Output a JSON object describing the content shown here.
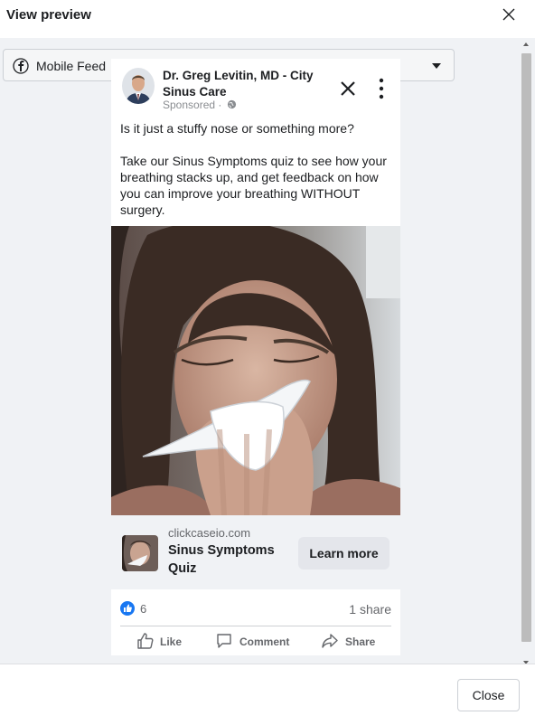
{
  "header": {
    "title": "View preview"
  },
  "placement_select": {
    "value": "Mobile Feed"
  },
  "ad": {
    "page_name": "Dr. Greg Levitin, MD - City Sinus Care",
    "sponsored": "Sponsored ·",
    "primary_text_1": "Is it just a stuffy nose or something more?",
    "primary_text_2": "Take our Sinus Symptoms quiz to see how your breathing stacks up, and get feedback on how you can improve your breathing WITHOUT surgery.",
    "link_domain": "clickcaseio.com",
    "link_headline": "Sinus Symptoms Quiz",
    "cta_label": "Learn more",
    "reaction_count": "6",
    "share_count": "1 share",
    "actions": {
      "like": "Like",
      "comment": "Comment",
      "share": "Share"
    }
  },
  "footer": {
    "close_label": "Close"
  },
  "icons": {
    "close": "close-icon",
    "facebook": "facebook-icon",
    "dropdown": "caret-down-icon",
    "more": "more-vertical-icon",
    "globe": "globe-icon",
    "like_reaction": "like-reaction-icon",
    "like": "thumbs-up-icon",
    "comment": "comment-icon",
    "share": "share-icon"
  },
  "colors": {
    "accent": "#1877f2",
    "background": "#f0f2f5",
    "cta_bg": "#e4e6eb"
  }
}
